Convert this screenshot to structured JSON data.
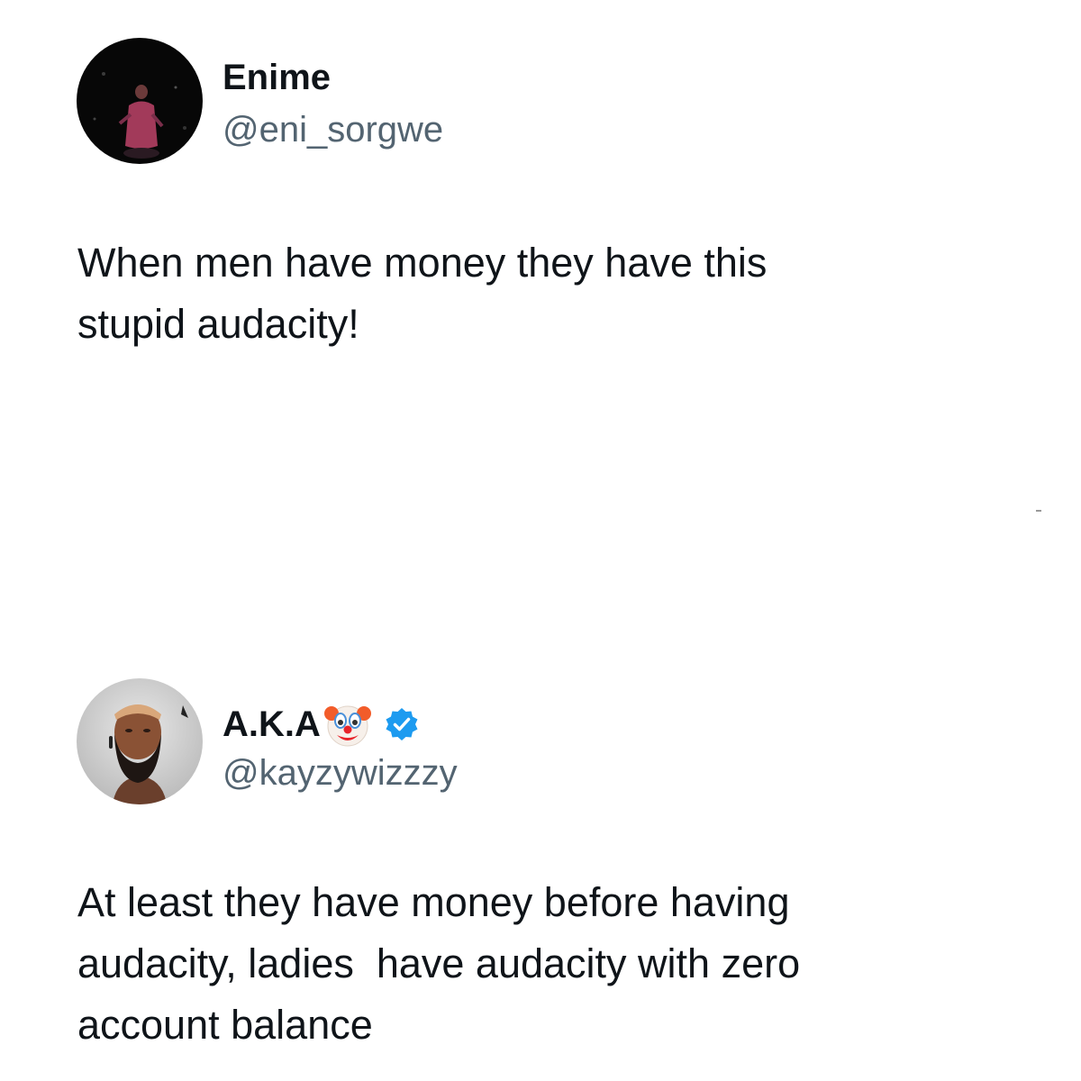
{
  "tweets": [
    {
      "display_name": "Enime",
      "handle": "@eni_sorgwe",
      "text": "When men have money they have this\nstupid audacity!",
      "avatar": "dark-photo-avatar"
    },
    {
      "display_name": "A.K.A",
      "name_emoji": "clown-face-icon",
      "verified": true,
      "verified_color": "#1d9bf0",
      "handle": "@kayzywizzzy",
      "text": "At least they have money before having\naudacity, ladies  have audacity with zero\naccount balance",
      "avatar": "bearded-man-avatar"
    }
  ],
  "colors": {
    "name": "#0f1419",
    "handle": "#536471",
    "verified": "#1d9bf0",
    "background": "#ffffff"
  }
}
